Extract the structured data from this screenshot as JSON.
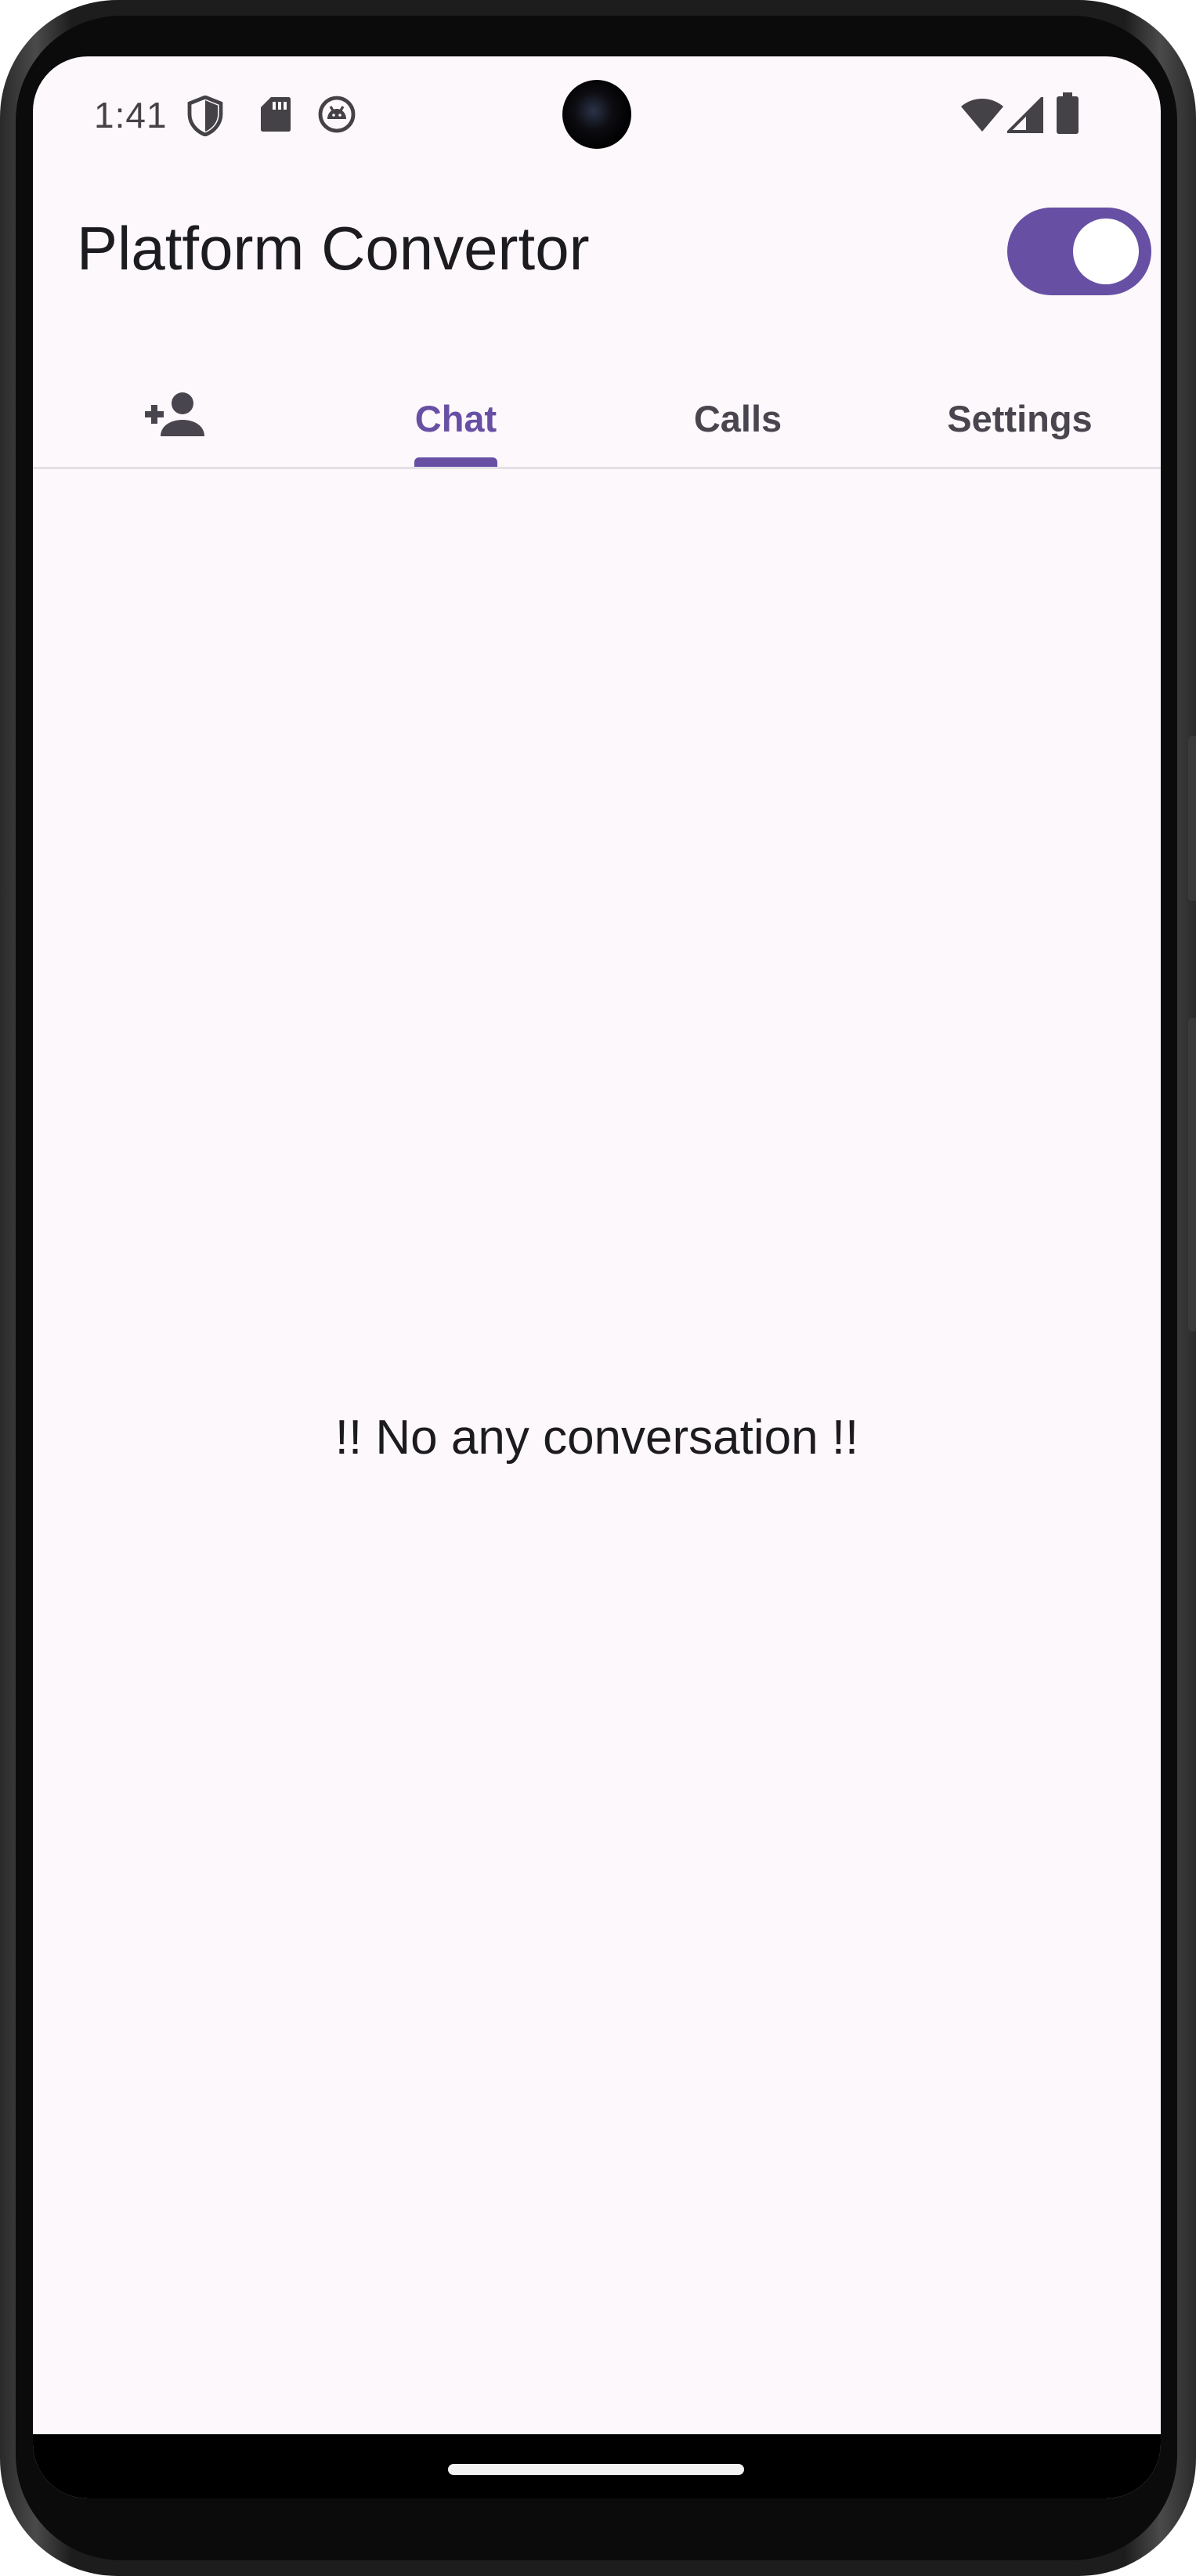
{
  "status_bar": {
    "time": "1:41",
    "left_icons": [
      "shield-icon",
      "sd-card-icon",
      "android-debug-icon"
    ],
    "right_icons": [
      "wifi-icon",
      "signal-icon",
      "battery-icon"
    ]
  },
  "app_bar": {
    "title": "Platform Convertor",
    "toggle_on": true
  },
  "tabs": [
    {
      "label": "",
      "icon": "person-add-icon",
      "active": false
    },
    {
      "label": "Chat",
      "active": true
    },
    {
      "label": "Calls",
      "active": false
    },
    {
      "label": "Settings",
      "active": false
    }
  ],
  "content": {
    "empty_message": "!! No any conversation !!"
  },
  "colors": {
    "primary": "#6750a4",
    "background": "#fdf8fb",
    "text": "#1c1b1f",
    "tab_inactive": "#49454f"
  }
}
